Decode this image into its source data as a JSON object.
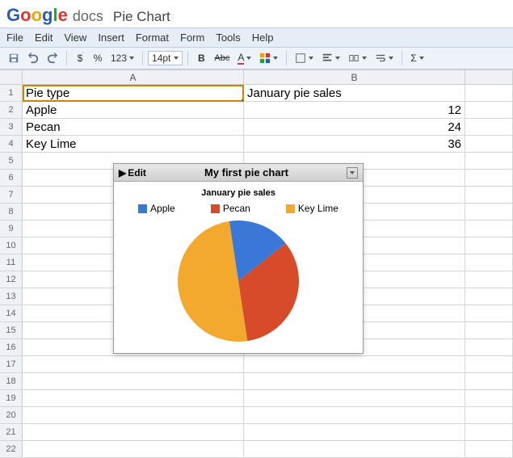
{
  "logo": "Google",
  "product": "docs",
  "doc_title": "Pie Chart",
  "menu": {
    "file": "File",
    "edit": "Edit",
    "view": "View",
    "insert": "Insert",
    "format": "Format",
    "form": "Form",
    "tools": "Tools",
    "help": "Help"
  },
  "toolbar": {
    "currency": "$",
    "percent": "%",
    "numfmt": "123",
    "fontsize": "14pt",
    "bold": "B",
    "strike": "Abc",
    "textcolor": "A",
    "sigma": "Σ"
  },
  "columns": {
    "A": "A",
    "B": "B"
  },
  "rows": [
    "1",
    "2",
    "3",
    "4",
    "5",
    "6",
    "7",
    "8",
    "9",
    "10",
    "11",
    "12",
    "13",
    "14",
    "15",
    "16",
    "17",
    "18",
    "19",
    "20",
    "21",
    "22"
  ],
  "cells": {
    "A1": "Pie type",
    "B1": "January pie sales",
    "A2": "Apple",
    "B2": "12",
    "A3": "Pecan",
    "B3": "24",
    "A4": "Key Lime",
    "B4": "36"
  },
  "chart": {
    "edit_label": "Edit",
    "title": "My first pie chart",
    "subtitle": "January pie sales",
    "legend": {
      "apple": "Apple",
      "pecan": "Pecan",
      "keylime": "Key Lime"
    },
    "colors": {
      "apple": "#3a78d8",
      "pecan": "#d84b2a",
      "keylime": "#f2a92e"
    }
  },
  "chart_data": {
    "type": "pie",
    "title": "My first pie chart",
    "subtitle": "January pie sales",
    "series": [
      {
        "name": "Apple",
        "value": 12,
        "color": "#3a78d8"
      },
      {
        "name": "Pecan",
        "value": 24,
        "color": "#d84b2a"
      },
      {
        "name": "Key Lime",
        "value": 36,
        "color": "#f2a92e"
      }
    ]
  }
}
